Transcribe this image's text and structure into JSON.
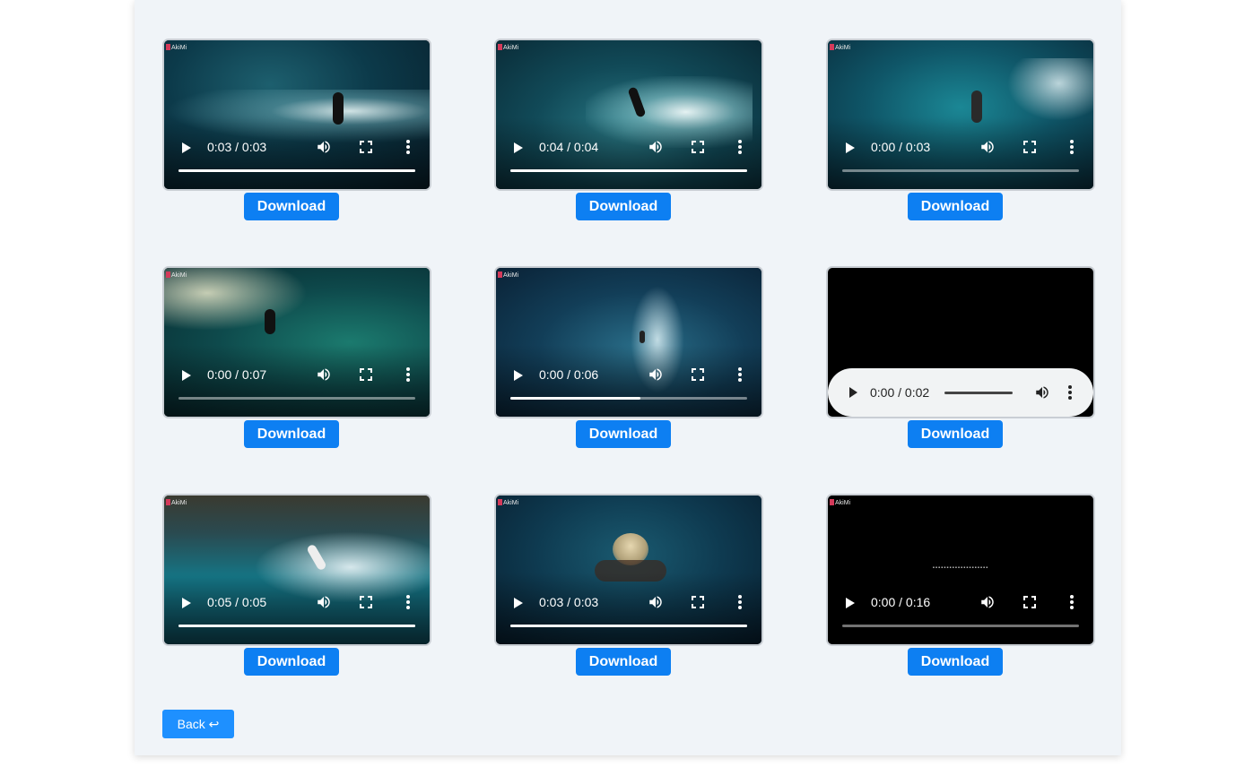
{
  "videos": [
    {
      "time": "0:03 / 0:03",
      "progress": 1.0
    },
    {
      "time": "0:04 / 0:04",
      "progress": 1.0
    },
    {
      "time": "0:00 / 0:03",
      "progress": 0.0
    },
    {
      "time": "0:00 / 0:07",
      "progress": 0.0
    },
    {
      "time": "0:00 / 0:06",
      "progress": 0.55
    },
    {
      "time": "0:00 / 0:02",
      "progress": 0.0,
      "type": "audio"
    },
    {
      "time": "0:05 / 0:05",
      "progress": 1.0
    },
    {
      "time": "0:03 / 0:03",
      "progress": 1.0
    },
    {
      "time": "0:00 / 0:16",
      "progress": 0.0
    }
  ],
  "download_label": "Download",
  "back_label": "Back ↩",
  "logo_text": "AkiMi",
  "colors": {
    "panel_bg": "#f0f4f8",
    "download_btn": "#0d7ff2",
    "back_btn": "#1e90ff"
  }
}
